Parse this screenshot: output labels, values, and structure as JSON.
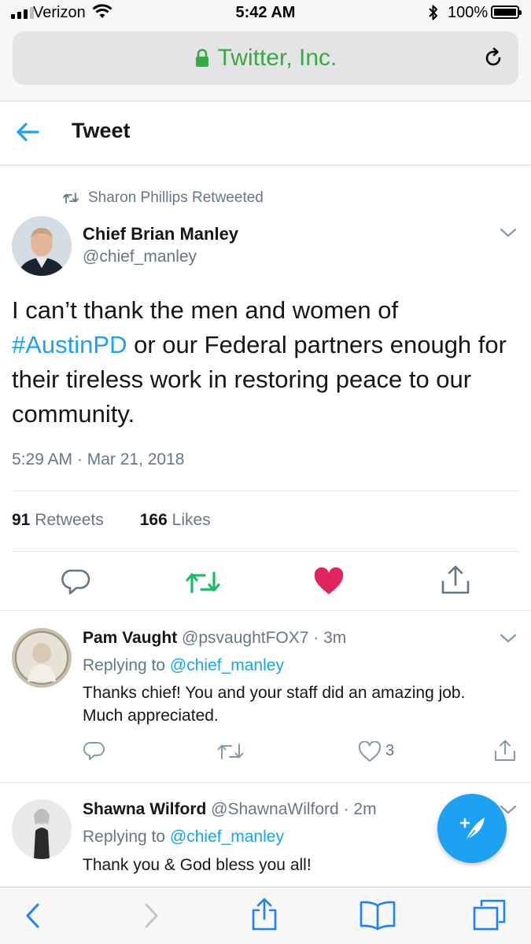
{
  "status_bar": {
    "carrier": "Verizon",
    "time": "5:42 AM",
    "battery_percent": "100%"
  },
  "url_bar": {
    "site": "Twitter, Inc."
  },
  "header": {
    "title": "Tweet"
  },
  "tweet": {
    "retweeted_by": "Sharon Phillips Retweeted",
    "author_name": "Chief Brian Manley",
    "author_handle": "@chief_manley",
    "text_before": "I can’t thank the men and women of",
    "hashtag": "#AustinPD",
    "text_after": " or our Federal partners enough for their tireless work in restoring peace to our community.",
    "timestamp": "5:29 AM · Mar 21, 2018",
    "retweet_count": "91",
    "retweets_label": "Retweets",
    "like_count": "166",
    "likes_label": "Likes"
  },
  "replies": [
    {
      "name": "Pam Vaught",
      "handle": "@psvaughtFOX7",
      "time": "3m",
      "replying_label": "Replying to ",
      "replying_to": "@chief_manley",
      "text": "Thanks chief!  You and your staff did an amazing job. Much appreciated.",
      "likes": "3"
    },
    {
      "name": "Shawna Wilford",
      "handle": "@ShawnaWilford",
      "time": "2m",
      "replying_label": "Replying to ",
      "replying_to": "@chief_manley",
      "text": "Thank you & God bless you all!"
    }
  ],
  "colors": {
    "twitter_blue": "#1da1f2",
    "retweet_green": "#17bf63",
    "like_red": "#e0245e",
    "secure_green": "#3aa844",
    "secondary_text": "#657786"
  },
  "icons": {
    "back": "arrow-left-icon",
    "lock": "lock-icon",
    "reload": "reload-icon",
    "reply": "reply-icon",
    "retweet": "retweet-icon",
    "like": "heart-icon",
    "share": "share-icon",
    "compose": "compose-feather-icon"
  }
}
